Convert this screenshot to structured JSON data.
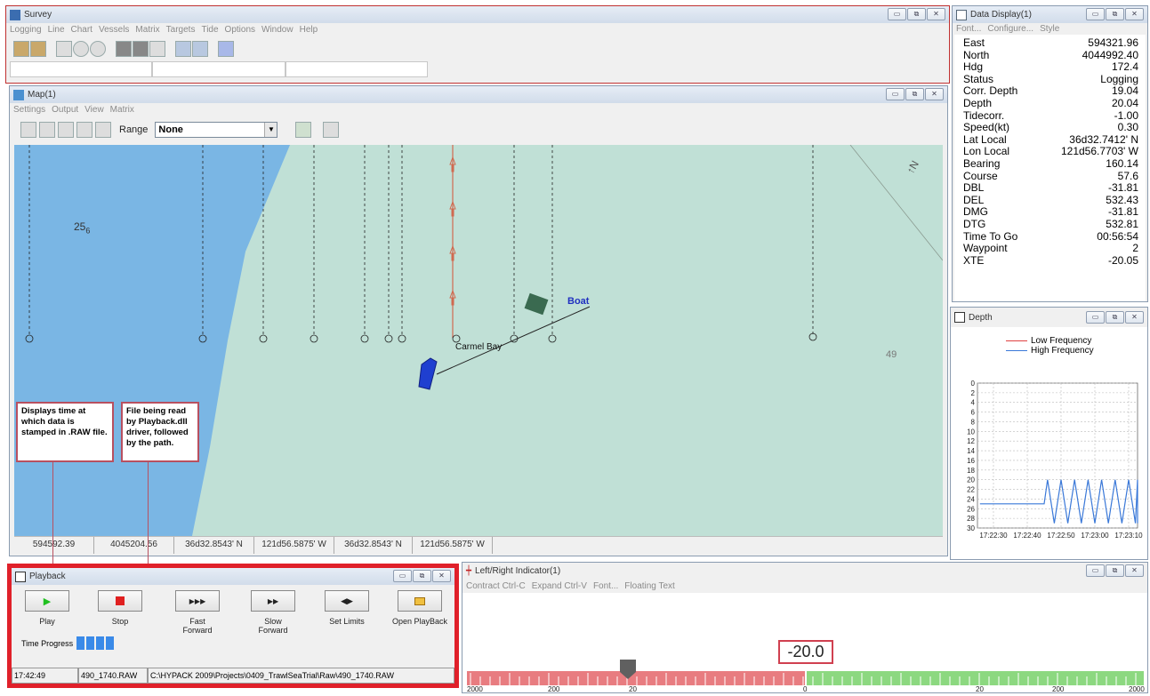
{
  "survey": {
    "title": "Survey",
    "menu": [
      "Logging",
      "Line",
      "Chart",
      "Vessels",
      "Matrix",
      "Targets",
      "Tide",
      "Options",
      "Window",
      "Help"
    ]
  },
  "map": {
    "title": "Map(1)",
    "menu": [
      "Settings",
      "Output",
      "View",
      "Matrix"
    ],
    "range_label": "Range",
    "range_value": "None",
    "soundings": {
      "s1": "25",
      "s1_sub": "6",
      "s2": "49"
    },
    "place_label": "Carmel Bay",
    "boat_label": "Boat",
    "status": [
      "594592.39",
      "4045204.56",
      "36d32.8543' N",
      "121d56.5875' W",
      "36d32.8543' N",
      "121d56.5875' W"
    ]
  },
  "callouts": {
    "time": "Displays time at which data is stamped in .RAW file.",
    "file": "File being read by Playback.dll driver, followed by the path."
  },
  "data_display": {
    "title": "Data Display(1)",
    "menu": [
      "Font...",
      "Configure...",
      "Style"
    ],
    "rows": [
      {
        "label": "East",
        "value": "594321.96"
      },
      {
        "label": "North",
        "value": "4044992.40"
      },
      {
        "label": "Hdg",
        "value": "172.4"
      },
      {
        "label": "Status",
        "value": "Logging"
      },
      {
        "label": "Corr. Depth",
        "value": "19.04"
      },
      {
        "label": "Depth",
        "value": "20.04"
      },
      {
        "label": "Tidecorr.",
        "value": "-1.00"
      },
      {
        "label": "Speed(kt)",
        "value": "0.30"
      },
      {
        "label": "Lat Local",
        "value": "36d32.7412' N"
      },
      {
        "label": "Lon Local",
        "value": "121d56.7703' W"
      },
      {
        "label": "Bearing",
        "value": "160.14"
      },
      {
        "label": "Course",
        "value": "57.6"
      },
      {
        "label": "DBL",
        "value": "-31.81"
      },
      {
        "label": "DEL",
        "value": "532.43"
      },
      {
        "label": "DMG",
        "value": "-31.81"
      },
      {
        "label": "DTG",
        "value": "532.81"
      },
      {
        "label": "Time To Go",
        "value": "00:56:54"
      },
      {
        "label": "Waypoint",
        "value": "2"
      },
      {
        "label": "XTE",
        "value": "-20.05"
      }
    ]
  },
  "depth": {
    "title": "Depth",
    "legend": [
      "Low Frequency",
      "High Frequency"
    ],
    "colors": {
      "low": "#e04040",
      "high": "#3a78d8"
    }
  },
  "chart_data": {
    "type": "line",
    "title": "Depth",
    "ylim": [
      0,
      30
    ],
    "y_inverted": true,
    "y_ticks": [
      0,
      2,
      4,
      6,
      8,
      10,
      12,
      14,
      16,
      18,
      20,
      22,
      24,
      26,
      28,
      30
    ],
    "x_ticks": [
      "17:22:30",
      "17:22:40",
      "17:22:50",
      "17:23:00",
      "17:23:10"
    ],
    "grid": true,
    "legend_position": "top",
    "series": [
      {
        "name": "High Frequency",
        "color": "#3a78d8",
        "x": [
          "17:22:26",
          "17:22:45",
          "17:22:46",
          "17:22:48",
          "17:22:50",
          "17:22:52",
          "17:22:54",
          "17:22:56",
          "17:22:58",
          "17:23:00",
          "17:23:02",
          "17:23:04",
          "17:23:06",
          "17:23:08",
          "17:23:10",
          "17:23:12",
          "17:23:14",
          "17:23:16",
          "17:23:18"
        ],
        "values": [
          25,
          25,
          20,
          29,
          20,
          29,
          20,
          29,
          20,
          29,
          20,
          29,
          20,
          29,
          20,
          29,
          20,
          29,
          20
        ]
      }
    ]
  },
  "playback": {
    "title": "Playback",
    "buttons": [
      "Play",
      "Stop",
      "Fast Forward",
      "Slow Forward",
      "Set Limits",
      "Open PlayBack"
    ],
    "time_progress_label": "Time Progress",
    "time": "17:42:49",
    "file": "490_1740.RAW",
    "path": "C:\\HYPACK 2009\\Projects\\0409_TrawlSeaTrial\\Raw\\490_1740.RAW"
  },
  "lr_indicator": {
    "title": "Left/Right Indicator(1)",
    "menu": [
      "Contract Ctrl-C",
      "Expand Ctrl-V",
      "Font...",
      "Floating Text"
    ],
    "value": "-20.0",
    "scale_labels": [
      "2000",
      "200",
      "20",
      "0",
      "20",
      "200",
      "2000"
    ],
    "colors": {
      "left": "#e87c80",
      "right": "#8cd880"
    }
  }
}
